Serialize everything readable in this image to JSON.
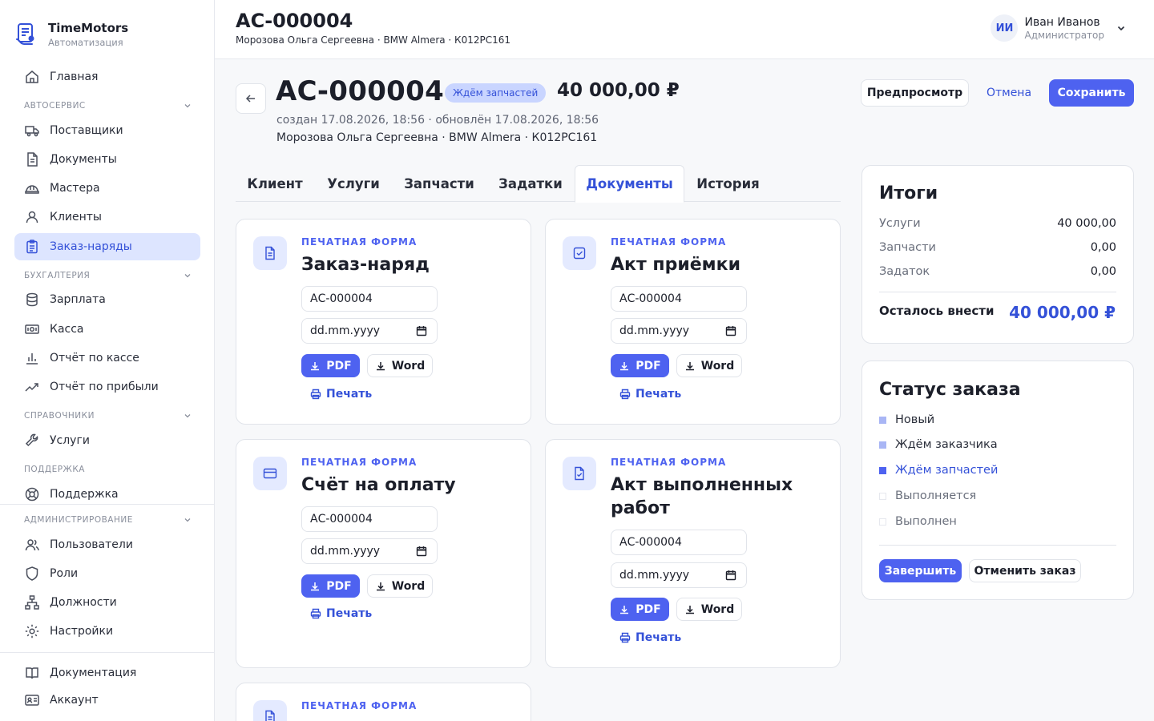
{
  "brand": {
    "name": "TimeMotors",
    "subtitle": "Автоматизация"
  },
  "sidebar": {
    "home": "Главная",
    "sections": [
      {
        "title": "АВТОСЕРВИС",
        "items": [
          "Поставщики",
          "Документы",
          "Мастера",
          "Клиенты",
          "Заказ-наряды"
        ]
      },
      {
        "title": "БУХГАЛТЕРИЯ",
        "items": [
          "Зарплата",
          "Касса",
          "Отчёт по кассе",
          "Отчёт по прибыли"
        ]
      },
      {
        "title": "СПРАВОЧНИКИ",
        "items": [
          "Услуги"
        ]
      },
      {
        "title": "ПОДДЕРЖКА",
        "items": [
          "Поддержка"
        ]
      },
      {
        "title": "АДМИНИСТРИРОВАНИЕ",
        "items": [
          "Пользователи",
          "Роли",
          "Должности",
          "Настройки"
        ]
      }
    ],
    "bottom": [
      "Документация",
      "Аккаунт"
    ],
    "active_item": "Заказ-наряды"
  },
  "topbar": {
    "title": "АС-000004",
    "subtitle": "Морозова Ольга Сергеевна · BMW Almera · К012РС161",
    "user": {
      "initials": "ИИ",
      "name": "Иван Иванов",
      "role": "Администратор"
    }
  },
  "header": {
    "title": "АС-000004",
    "status": "Ждём запчастей",
    "amount": "40 000,00 ₽",
    "meta_dates": "создан 17.08.2026, 18:56 · обновлён 17.08.2026, 18:56",
    "meta_client": "Морозова Ольга Сергеевна · BMW Almera · К012РС161",
    "actions": {
      "preview": "Предпросмотр",
      "cancel": "Отмена",
      "save": "Сохранить"
    }
  },
  "tabs": [
    "Клиент",
    "Услуги",
    "Запчасти",
    "Задатки",
    "Документы",
    "История"
  ],
  "active_tab": "Документы",
  "documents": [
    {
      "kicker": "ПЕЧАТНАЯ ФОРМА",
      "title": "Заказ-наряд",
      "number": "АС-000004",
      "date_placeholder": "dd.mm.yyyy",
      "pdf": "PDF",
      "word": "Word",
      "print": "Печать",
      "icon": "document-icon"
    },
    {
      "kicker": "ПЕЧАТНАЯ ФОРМА",
      "title": "Акт приёмки",
      "number": "АС-000004",
      "date_placeholder": "dd.mm.yyyy",
      "pdf": "PDF",
      "word": "Word",
      "print": "Печать",
      "icon": "checkbox-icon"
    },
    {
      "kicker": "ПЕЧАТНАЯ ФОРМА",
      "title": "Счёт на оплату",
      "number": "АС-000004",
      "date_placeholder": "dd.mm.yyyy",
      "pdf": "PDF",
      "word": "Word",
      "print": "Печать",
      "icon": "credit-card-icon"
    },
    {
      "kicker": "ПЕЧАТНАЯ ФОРМА",
      "title": "Акт выполненных работ",
      "number": "АС-000004",
      "date_placeholder": "dd.mm.yyyy",
      "pdf": "PDF",
      "word": "Word",
      "print": "Печать",
      "icon": "file-check-icon"
    },
    {
      "kicker": "ПЕЧАТНАЯ ФОРМА",
      "icon": "document-icon"
    }
  ],
  "totals": {
    "title": "Итоги",
    "rows": [
      {
        "label": "Услуги",
        "value": "40 000,00"
      },
      {
        "label": "Запчасти",
        "value": "0,00"
      },
      {
        "label": "Задаток",
        "value": "0,00"
      }
    ],
    "remaining_label": "Осталось внести",
    "remaining_value": "40 000,00 ₽"
  },
  "order_status": {
    "title": "Статус заказа",
    "steps": [
      {
        "label": "Новый",
        "state": "done"
      },
      {
        "label": "Ждём заказчика",
        "state": "done"
      },
      {
        "label": "Ждём запчастей",
        "state": "current"
      },
      {
        "label": "Выполняется",
        "state": "pending"
      },
      {
        "label": "Выполнен",
        "state": "pending"
      }
    ],
    "finish": "Завершить",
    "cancel_order": "Отменить заказ"
  },
  "colors": {
    "accent": "#4e62f0",
    "accent_text": "#3451d8",
    "active_bg": "#dde5ff",
    "pill_bg": "#c9d5ff"
  }
}
